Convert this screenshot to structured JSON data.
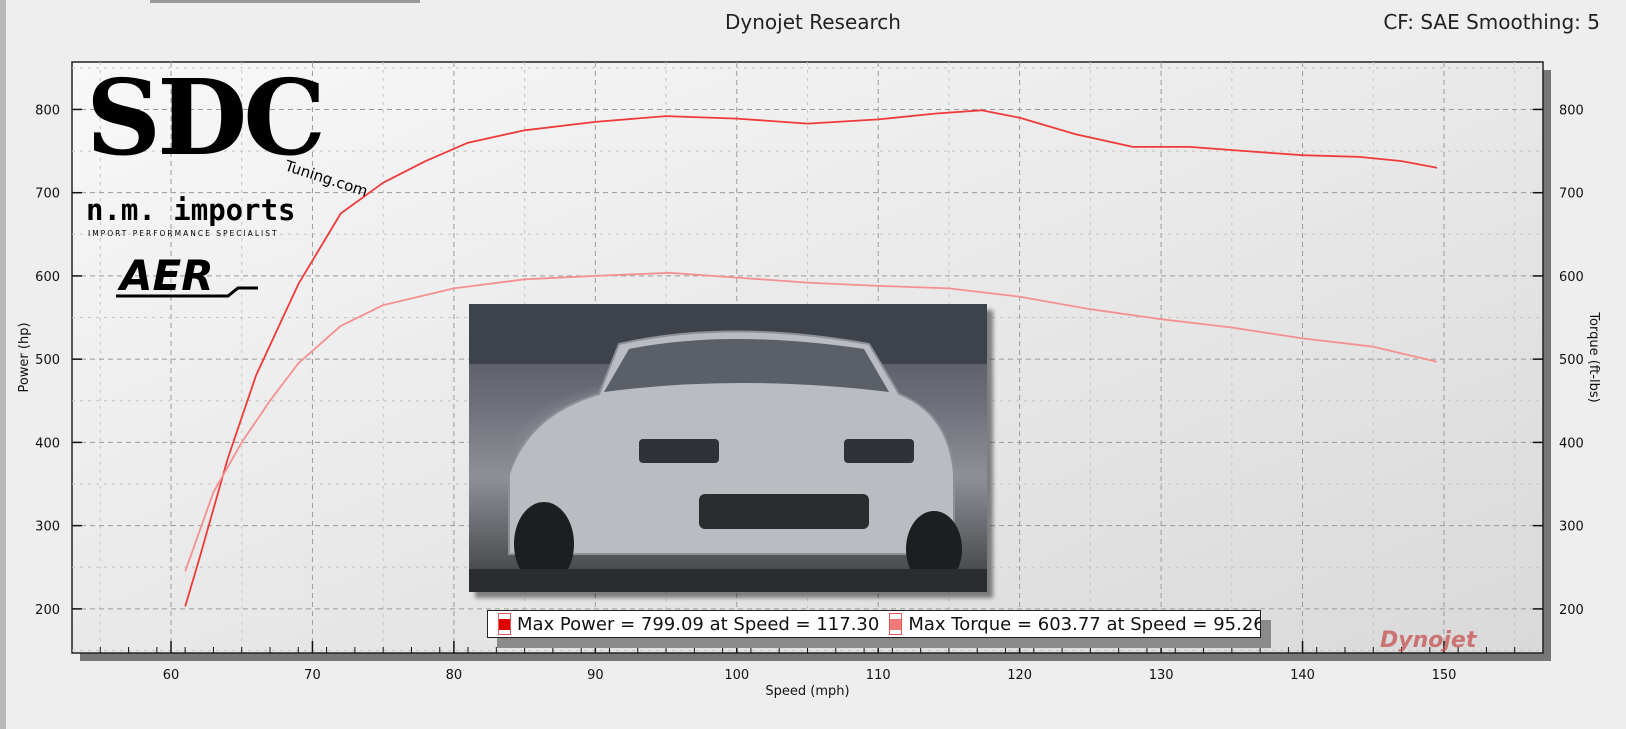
{
  "header": {
    "title": "Dynojet Research",
    "cf_text": "CF: SAE Smoothing: 5"
  },
  "legend": {
    "power_text": "Max Power = 799.09 at Speed = 117.30",
    "torque_text": "Max Torque = 603.77 at Speed = 95.26",
    "power_color": "#e00000",
    "torque_color": "#f07a7a"
  },
  "logos": {
    "sdc": "SDC",
    "sdc_sub": "Tuning.com",
    "nm": "n.m. imports",
    "nm_sub": "IMPORT PERFORMANCE SPECIALIST",
    "aer": "AER",
    "dynojet": "Dynojet"
  },
  "chart_data": {
    "type": "line",
    "title": "Dynojet Research",
    "xlabel": "Speed (mph)",
    "ylabel": "Power (hp)",
    "y2label": "Torque (ft-lbs)",
    "xlim": [
      53,
      157
    ],
    "ylim": [
      147,
      857
    ],
    "y2lim": [
      147,
      857
    ],
    "xticks": [
      60,
      70,
      80,
      90,
      100,
      110,
      120,
      130,
      140,
      150
    ],
    "yticks": [
      200,
      300,
      400,
      500,
      600,
      700,
      800
    ],
    "grid": true,
    "series": [
      {
        "name": "Power",
        "color": "#f03a3a",
        "x": [
          61,
          62,
          64,
          66,
          69,
          72,
          75,
          78,
          81,
          85,
          90,
          95,
          100,
          105,
          110,
          114,
          117.3,
          120,
          124,
          128,
          132,
          136,
          140,
          144,
          147,
          149.5
        ],
        "y": [
          203,
          260,
          380,
          480,
          590,
          675,
          712,
          738,
          760,
          775,
          785,
          792,
          789,
          783,
          788,
          795,
          799,
          790,
          770,
          755,
          755,
          750,
          745,
          743,
          738,
          730
        ]
      },
      {
        "name": "Torque",
        "color": "#f59090",
        "x": [
          61,
          63,
          65,
          67,
          69,
          72,
          75,
          80,
          85,
          90,
          95.26,
          100,
          105,
          110,
          115,
          120,
          125,
          130,
          135,
          140,
          145,
          149.5
        ],
        "y": [
          245,
          340,
          400,
          450,
          495,
          540,
          565,
          585,
          596,
          600,
          603.77,
          598,
          592,
          588,
          585,
          575,
          560,
          548,
          538,
          525,
          515,
          497
        ]
      }
    ]
  }
}
